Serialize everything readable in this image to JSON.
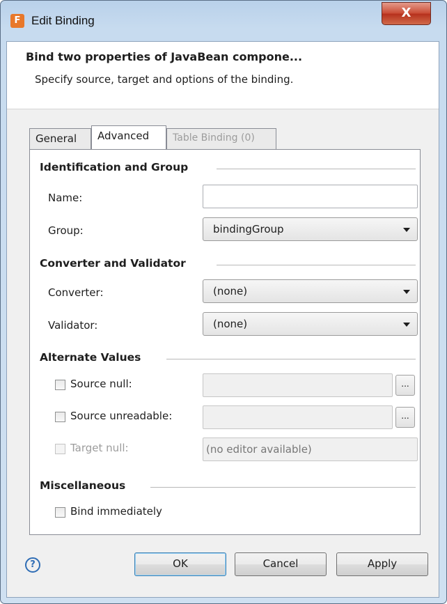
{
  "window": {
    "title": "Edit Binding",
    "app_icon_letter": "F",
    "close_label": "X"
  },
  "header": {
    "title": "Bind two properties of JavaBean compone...",
    "subtitle": "Specify source, target and options of the binding."
  },
  "tabs": [
    {
      "label": "General",
      "state": "inactive"
    },
    {
      "label": "Advanced",
      "state": "active"
    },
    {
      "label": "Table Binding (0)",
      "state": "disabled"
    }
  ],
  "sections": {
    "identification": {
      "title": "Identification and Group",
      "name_label": "Name:",
      "name_value": "",
      "group_label": "Group:",
      "group_value": "bindingGroup"
    },
    "converter": {
      "title": "Converter and Validator",
      "converter_label": "Converter:",
      "converter_value": "(none)",
      "validator_label": "Validator:",
      "validator_value": "(none)"
    },
    "alternate": {
      "title": "Alternate Values",
      "source_null_label": "Source null:",
      "source_unreadable_label": "Source unreadable:",
      "target_null_label": "Target null:",
      "target_null_value": "(no editor available)",
      "ellipsis_label": "..."
    },
    "misc": {
      "title": "Miscellaneous",
      "bind_immediately_label": "Bind immediately"
    }
  },
  "footer": {
    "help_label": "?",
    "ok_label": "OK",
    "cancel_label": "Cancel",
    "apply_label": "Apply"
  },
  "colors": {
    "frame": "#c7dbef",
    "default_button_border": "#3c7fb1",
    "help_icon": "#2f6db5",
    "close_button": "#c94a33"
  }
}
